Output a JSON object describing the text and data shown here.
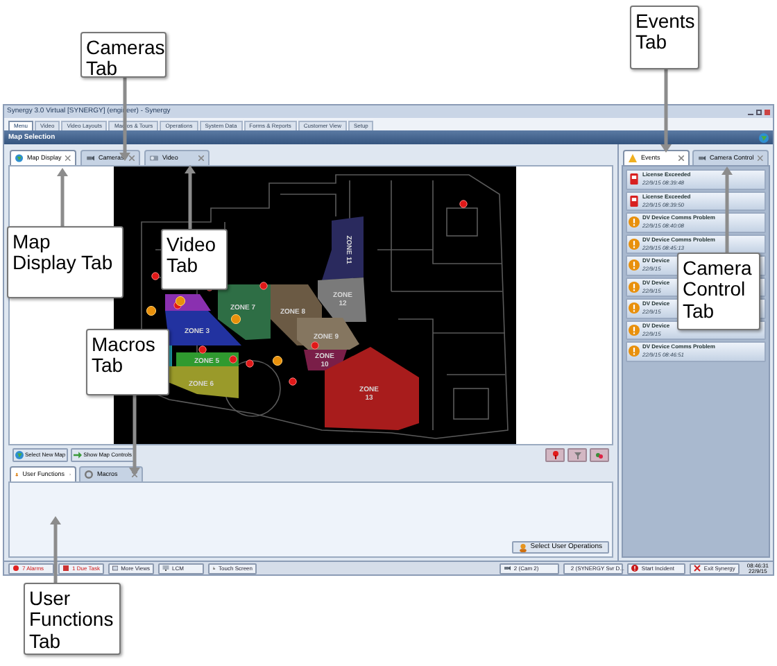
{
  "annotations": [
    {
      "text": "Cameras Tab"
    },
    {
      "text": "Events Tab"
    },
    {
      "text": "Map Display Tab"
    },
    {
      "text": "Video Tab"
    },
    {
      "text": "Macros Tab"
    },
    {
      "text": "Camera Control Tab"
    },
    {
      "text": "User Functions Tab"
    }
  ],
  "window": {
    "title": "Synergy 3.0 Virtual [SYNERGY] (engineer) - Synergy"
  },
  "menu_tabs": [
    {
      "label": "Menu",
      "selected": true
    },
    {
      "label": "Video",
      "selected": false
    },
    {
      "label": "Video Layouts",
      "selected": false
    },
    {
      "label": "Macros & Tours",
      "selected": false
    },
    {
      "label": "Operations",
      "selected": false
    },
    {
      "label": "System Data",
      "selected": false
    },
    {
      "label": "Forms & Reports",
      "selected": false
    },
    {
      "label": "Customer View",
      "selected": false
    },
    {
      "label": "Setup",
      "selected": false
    }
  ],
  "section_title": "Map Selection",
  "map_tabs": [
    {
      "label": "Map Display",
      "kind": "globe",
      "selected": true
    },
    {
      "label": "Cameras",
      "kind": "camera",
      "selected": false
    },
    {
      "label": "Video",
      "kind": "video",
      "selected": false
    }
  ],
  "zones": [
    {
      "label": "ZONE 11",
      "color": "#2a2a5e"
    },
    {
      "label": "ZONE 12",
      "color": "#7a7a7a"
    },
    {
      "label": "ZONE 7",
      "color": "#2e6e45"
    },
    {
      "label": "ZONE 8",
      "color": "#6b5a44"
    },
    {
      "label": "ZONE 9",
      "color": "#857660"
    },
    {
      "label": "ZONE 10",
      "color": "#7a1e48"
    },
    {
      "label": "ZONE 13",
      "color": "#a81c1c"
    },
    {
      "label": "ZONE 3",
      "color": "#2232a0"
    },
    {
      "label": "ZONE 5",
      "color": "#2f9a2f"
    },
    {
      "label": "ZONE 6",
      "color": "#9a9a2a"
    }
  ],
  "map_buttons": [
    {
      "label": "Select New Map",
      "kind": "globe"
    },
    {
      "label": "Show Map Controls",
      "kind": "arrow"
    }
  ],
  "lower_tabs": [
    {
      "label": "User Functions",
      "kind": "user",
      "selected": true
    },
    {
      "label": "Macros",
      "kind": "macro",
      "selected": false
    }
  ],
  "user_operations_button": "Select User Operations",
  "side_tabs": [
    {
      "label": "Events",
      "kind": "warning",
      "selected": true
    },
    {
      "label": "Camera Control",
      "kind": "camera",
      "selected": false
    }
  ],
  "events": [
    {
      "kind": "license",
      "title": "License Exceeded",
      "time": "22/9/15 08:39:48"
    },
    {
      "kind": "license",
      "title": "License Exceeded",
      "time": "22/9/15 08:39:50"
    },
    {
      "kind": "device",
      "title": "DV Device Comms Problem",
      "time": "22/9/15 08:40:08"
    },
    {
      "kind": "device",
      "title": "DV Device Comms Problem",
      "time": "22/9/15 08:45:13"
    },
    {
      "kind": "device",
      "title": "DV Device",
      "time": "22/9/15"
    },
    {
      "kind": "device",
      "title": "DV Device",
      "time": "22/9/15"
    },
    {
      "kind": "device",
      "title": "DV Device",
      "time": "22/9/15"
    },
    {
      "kind": "device",
      "title": "DV Device",
      "time": "22/9/15"
    },
    {
      "kind": "device",
      "title": "DV Device Comms Problem",
      "time": "22/9/15 08:46:51"
    }
  ],
  "taskbar_left": [
    {
      "label": "7 Alarms",
      "kind": "alarm"
    },
    {
      "label": "1 Due Task",
      "kind": "task"
    },
    {
      "label": "More Views",
      "kind": "views"
    },
    {
      "label": "LCM",
      "kind": "lcm"
    },
    {
      "label": "Touch Screen",
      "kind": "touch"
    }
  ],
  "taskbar_right": [
    {
      "label": "2 (Cam 2)",
      "kind": "camera"
    },
    {
      "label": "2 (SYNERGY Svr D...",
      "kind": "monitor"
    },
    {
      "label": "Start Incident",
      "kind": "incident"
    },
    {
      "label": "Exit Synergy",
      "kind": "exit"
    }
  ],
  "clock": {
    "time": "08:46:31",
    "date": "22/9/15"
  }
}
